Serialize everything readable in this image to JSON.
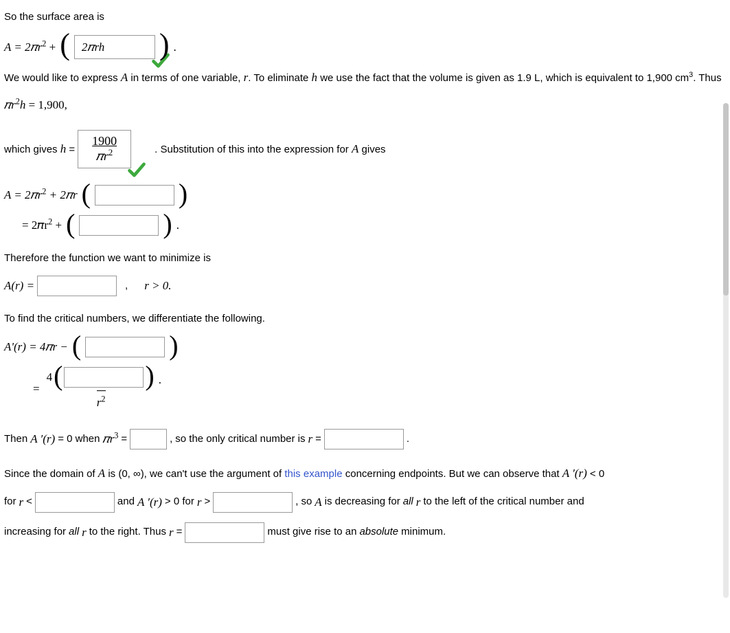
{
  "line1": "So the surface area is",
  "eq_area": {
    "lhs": "A = 2𝜋r",
    "lhs_sup": "2",
    "plus": " + ",
    "box_value": "2𝜋rh",
    "period": "."
  },
  "paragraph2_pre": "We would like to express ",
  "paragraph2_A": "A",
  "paragraph2_mid1": " in terms of one variable, ",
  "paragraph2_r": "r",
  "paragraph2_mid2": ". To eliminate ",
  "paragraph2_h": "h",
  "paragraph2_mid3": " we use the fact that the volume is given as 1.9 L, which is equivalent to 1,900 cm",
  "paragraph2_sup": "3",
  "paragraph2_end": ". Thus",
  "eq_vol_lhs": "𝜋r",
  "eq_vol_sup": "2",
  "eq_vol_h": "h",
  "eq_vol_rest": " = 1,900,",
  "gives_h_pre": "which gives ",
  "gives_h_h": "h",
  "gives_h_eq": " = ",
  "h_box": {
    "num": "1900",
    "den_pi": "𝜋r",
    "den_sup": "2"
  },
  "substitution_text": ". Substitution of this into the expression for ",
  "substitution_A": "A",
  "substitution_end": " gives",
  "eq_sub1": {
    "lhs": "A  =  2𝜋r",
    "lhs_sup": "2",
    "mid": " + 2𝜋r"
  },
  "eq_sub2": {
    "pre": "=  2𝜋r",
    "sup": "2",
    "plus": " + ",
    "period": "."
  },
  "therefore_text": "Therefore the function we want to minimize is",
  "eq_Ar": {
    "lhs": "A(r) = ",
    "comma": ",",
    "cond": "r > 0."
  },
  "crit_text": "To find the critical numbers, we differentiate the following.",
  "eq_Aprime1": {
    "lhs": "A'(r)  =  4𝜋r − "
  },
  "eq_Aprime2": {
    "eq": "=",
    "four": "4",
    "period": ".",
    "den_r": "r",
    "den_sup": "2"
  },
  "then_line": {
    "pre": "Then ",
    "Aprime": "A ′(r)",
    "mid1": " = 0 when ",
    "pir": "𝜋r",
    "pir_sup": "3",
    "eq": " = ",
    "comma": ",",
    "mid2": " so the only critical number is ",
    "r": "r",
    "eq2": " = ",
    "period": "."
  },
  "since_line": {
    "pre": "Since the domain of ",
    "A": "A",
    "mid1": " is (0, ∞), we can't use the argument of ",
    "link": "this example",
    "mid2": " concerning endpoints. But we can observe that ",
    "Aprime": "A ′(r)",
    "lt": " < 0"
  },
  "for_line": {
    "pre": "for ",
    "r": "r",
    "lt": " < ",
    "and": " and ",
    "Aprime": "A ′(r)",
    "gt": " > 0 for ",
    "r2": "r",
    "gt2": " > ",
    "comma2": " ,",
    "so": " so ",
    "A": "A",
    "mid": " is decreasing for ",
    "all": "all",
    "r3": " r",
    "end": " to the left of the critical number and"
  },
  "inc_line": {
    "pre": "increasing for ",
    "all": "all",
    "r": " r",
    "mid": " to the right. Thus ",
    "r2": "r",
    "eq": " = ",
    "end1": " must give rise to an ",
    "abs": "absolute",
    "end2": " minimum."
  }
}
